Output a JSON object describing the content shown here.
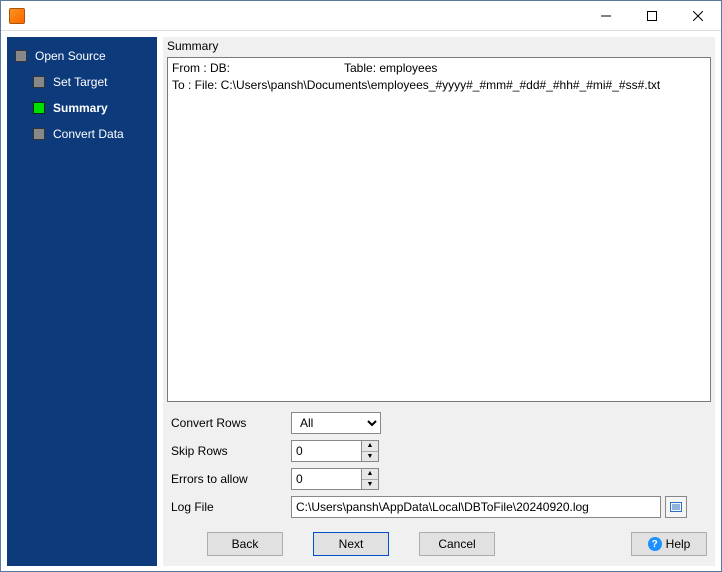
{
  "window": {
    "title": ""
  },
  "sidebar": {
    "items": [
      {
        "label": "Open Source",
        "active": false
      },
      {
        "label": "Set Target",
        "active": false
      },
      {
        "label": "Summary",
        "active": true
      },
      {
        "label": "Convert Data",
        "active": false
      }
    ]
  },
  "summary": {
    "header": "Summary",
    "from_prefix": "From : DB:",
    "from_table_label": "Table: employees",
    "to_line": "To : File: C:\\Users\\pansh\\Documents\\employees_#yyyy#_#mm#_#dd#_#hh#_#mi#_#ss#.txt"
  },
  "form": {
    "convert_rows": {
      "label": "Convert Rows",
      "value": "All"
    },
    "skip_rows": {
      "label": "Skip Rows",
      "value": "0"
    },
    "errors_allow": {
      "label": "Errors to allow",
      "value": "0"
    },
    "log_file": {
      "label": "Log File",
      "value": "C:\\Users\\pansh\\AppData\\Local\\DBToFile\\20240920.log"
    }
  },
  "buttons": {
    "back": "Back",
    "next": "Next",
    "cancel": "Cancel",
    "help": "Help"
  }
}
